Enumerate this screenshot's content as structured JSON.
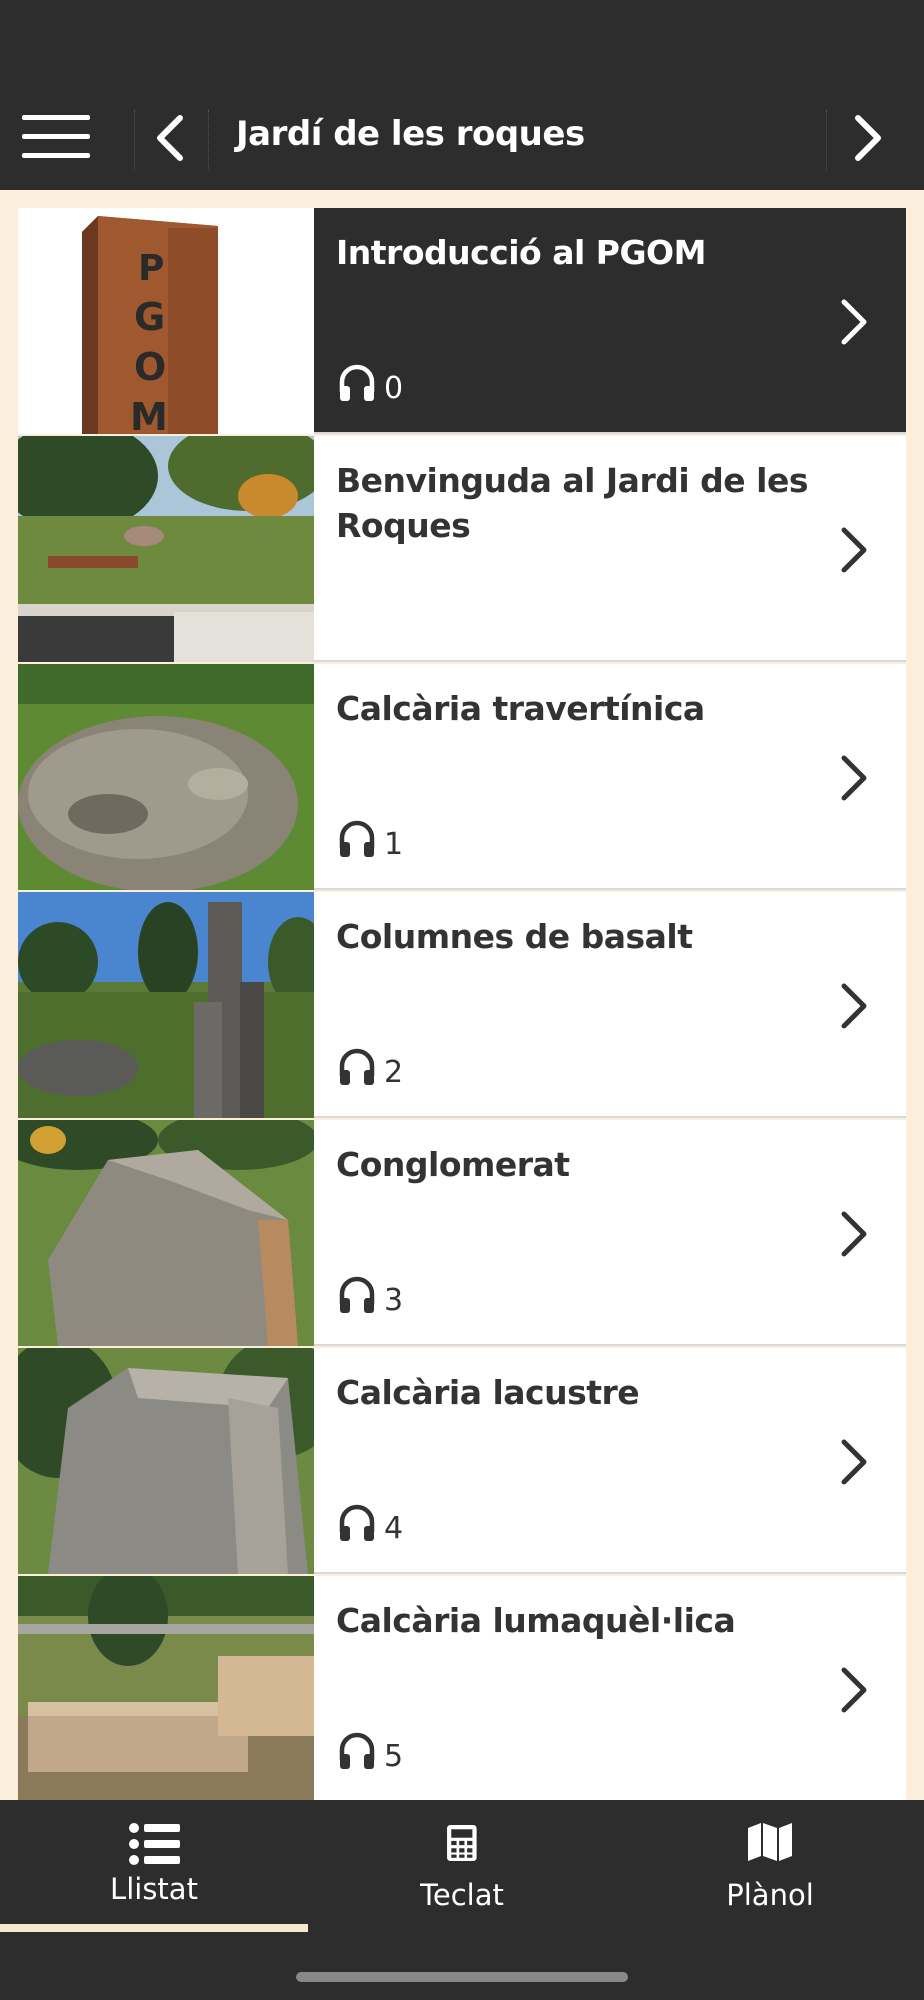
{
  "header": {
    "title": "Jardí de les roques",
    "menu_icon": "hamburger-menu-icon",
    "back_icon": "chevron-left-icon",
    "forward_icon": "chevron-right-icon"
  },
  "colors": {
    "header_bg": "#2d2d2d",
    "page_bg": "#fbefdc",
    "active_item_bg": "#2d2d2d",
    "tab_indicator": "#f6e7cf"
  },
  "items": [
    {
      "title": "Introducció al PGOM",
      "audio": "0",
      "active": true
    },
    {
      "title": "Benvinguda al Jardi de les Roques",
      "audio": "",
      "active": false
    },
    {
      "title": "Calcària travertínica",
      "audio": "1",
      "active": false
    },
    {
      "title": "Columnes de basalt",
      "audio": "2",
      "active": false
    },
    {
      "title": "Conglomerat",
      "audio": "3",
      "active": false
    },
    {
      "title": "Calcària lacustre",
      "audio": "4",
      "active": false
    },
    {
      "title": "Calcària lumaquèl·lica",
      "audio": "5",
      "active": false
    }
  ],
  "thumb_texts": {
    "pgom_sign": "PGOM"
  },
  "tabs": [
    {
      "label": "Llistat",
      "icon": "list-icon",
      "selected": true
    },
    {
      "label": "Teclat",
      "icon": "calculator-icon",
      "selected": false
    },
    {
      "label": "Plànol",
      "icon": "map-icon",
      "selected": false
    }
  ]
}
